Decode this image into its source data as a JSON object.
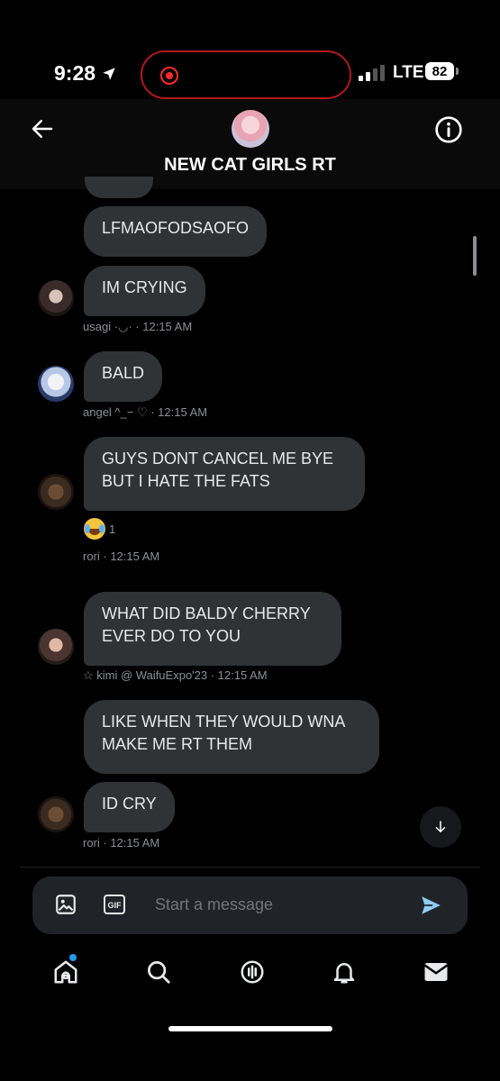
{
  "status_bar": {
    "time": "9:28",
    "network": "LTE",
    "battery": "82"
  },
  "header": {
    "title": "NEW CAT GIRLS RT"
  },
  "messages": [
    {
      "text": "LFMAOFODSAOFO"
    },
    {
      "text": "IM CRYING",
      "sender": "usagi",
      "meta": "usagi ·◡· · 12:15 AM"
    },
    {
      "text": "BALD",
      "sender": "angel",
      "meta": "angel ^_− ♡ · 12:15 AM"
    },
    {
      "text": "GUYS DONT CANCEL ME BYE BUT I HATE THE FATS",
      "line1": "GUYS DONT CANCEL ME BYE",
      "line2": "BUT I HATE THE FATS",
      "sender": "rori",
      "reaction_count": "1",
      "meta": "rori · 12:15 AM"
    },
    {
      "text": "WHAT DID BALDY CHERRY EVER DO TO YOU",
      "line1": "WHAT DID BALDY CHERRY",
      "line2": "EVER DO TO YOU",
      "sender": "kimi",
      "meta": "☆ kimi @ WaifuExpo'23 · 12:15 AM"
    },
    {
      "text": "LIKE WHEN THEY WOULD WNA MAKE ME RT THEM",
      "line1": "LIKE WHEN THEY WOULD WNA",
      "line2": "MAKE ME RT THEM"
    },
    {
      "text": "ID CRY",
      "sender": "rori",
      "meta": "rori · 12:15 AM"
    }
  ],
  "composer": {
    "placeholder": "Start a message",
    "gif_label": "GIF"
  },
  "icons": [
    "back-arrow-icon",
    "info-icon",
    "image-icon",
    "gif-icon",
    "send-icon",
    "home-icon",
    "search-icon",
    "spaces-icon",
    "bell-icon",
    "mail-icon",
    "arrow-down-icon"
  ],
  "colors": {
    "background": "#000000",
    "bubble": "#2f3336",
    "meta_text": "#8b8f94",
    "accent": "#1d9bf0",
    "record_red": "#ff2a2a"
  }
}
